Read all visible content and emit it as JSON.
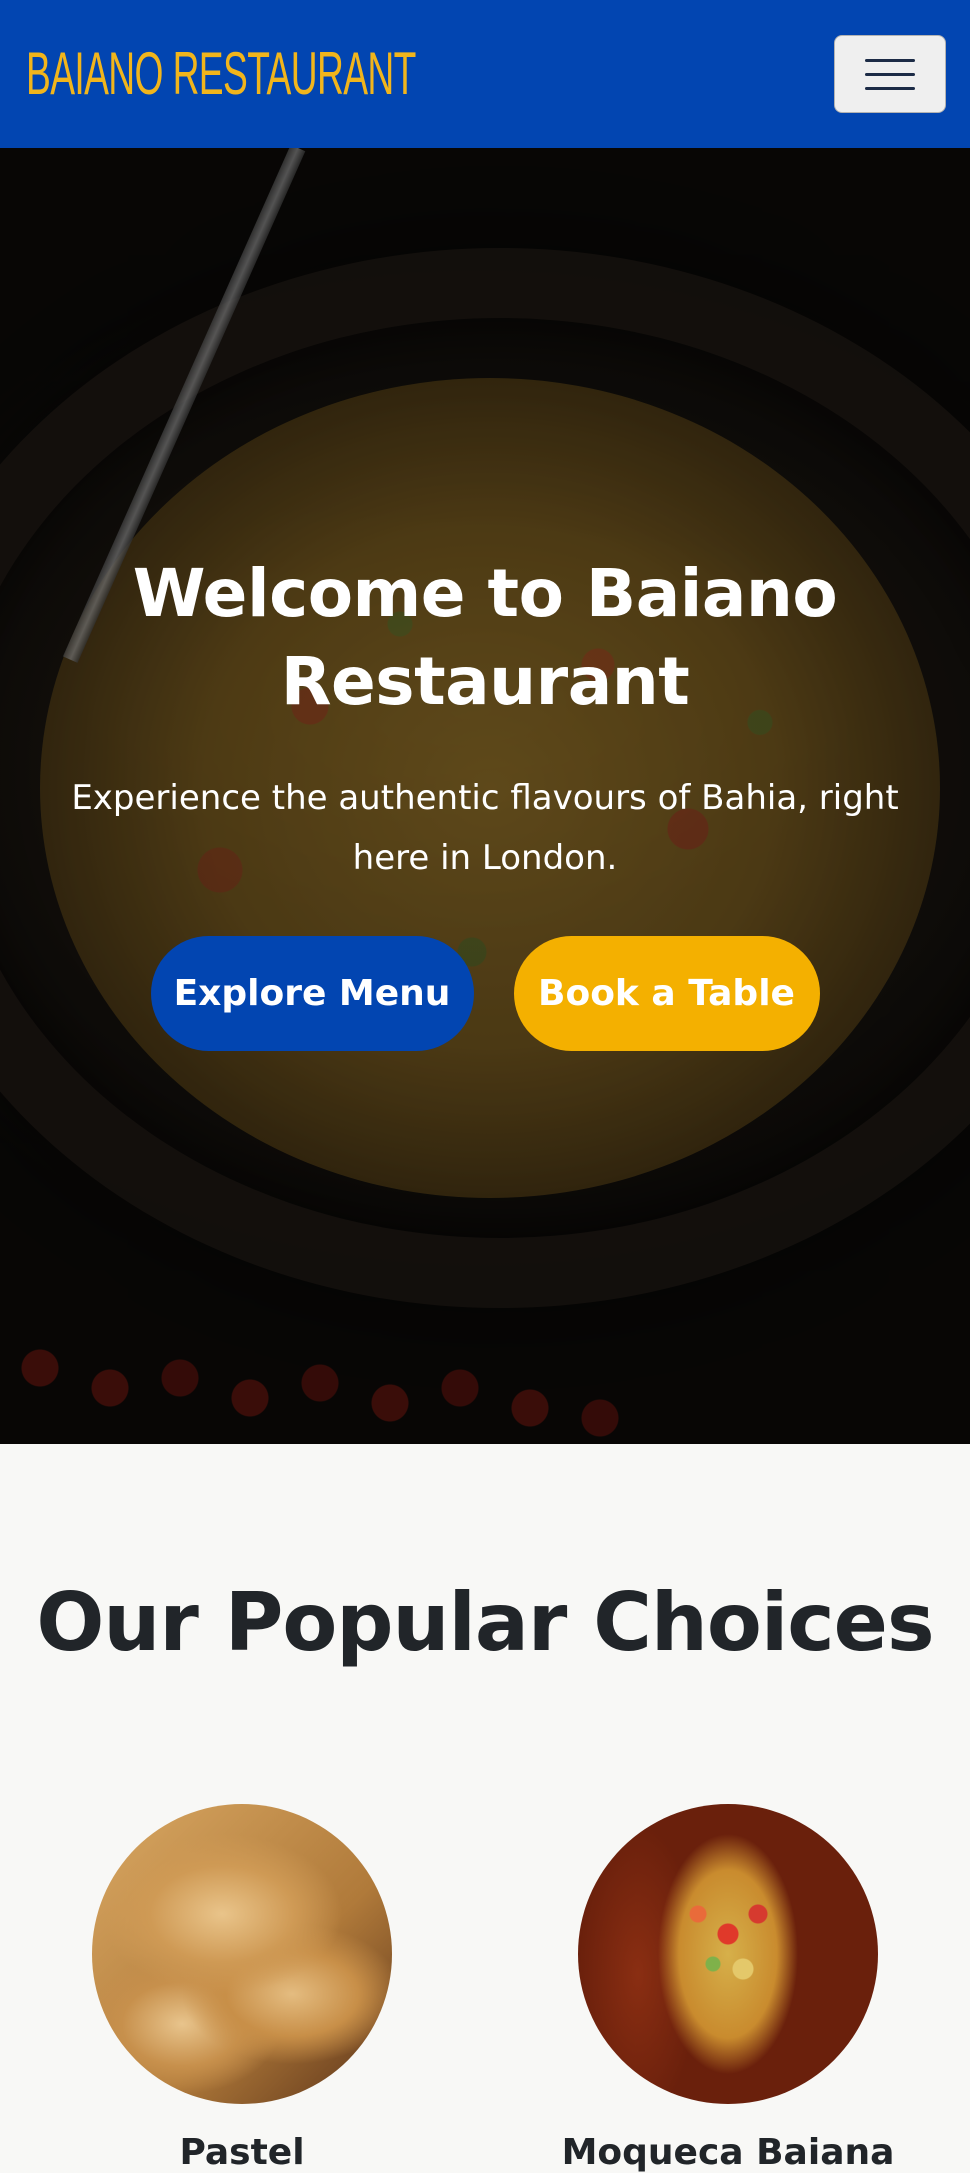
{
  "navbar": {
    "brand": "BAIANO RESTAURANT",
    "toggler_icon": "hamburger-menu-icon",
    "background": "#0245b1",
    "brand_color": "#f1b51c"
  },
  "hero": {
    "title": "Welcome to Baiano Restaurant",
    "subtitle": "Experience the authentic flavours of Bahia, right here in London.",
    "buttons": {
      "explore_menu": "Explore Menu",
      "book_table": "Book a Table"
    },
    "colors": {
      "primary": "#0245b1",
      "warning": "#f4b000"
    }
  },
  "popular": {
    "heading": "Our Popular Choices",
    "dishes": [
      {
        "name": "Pastel"
      },
      {
        "name": "Moqueca Baiana"
      }
    ]
  }
}
